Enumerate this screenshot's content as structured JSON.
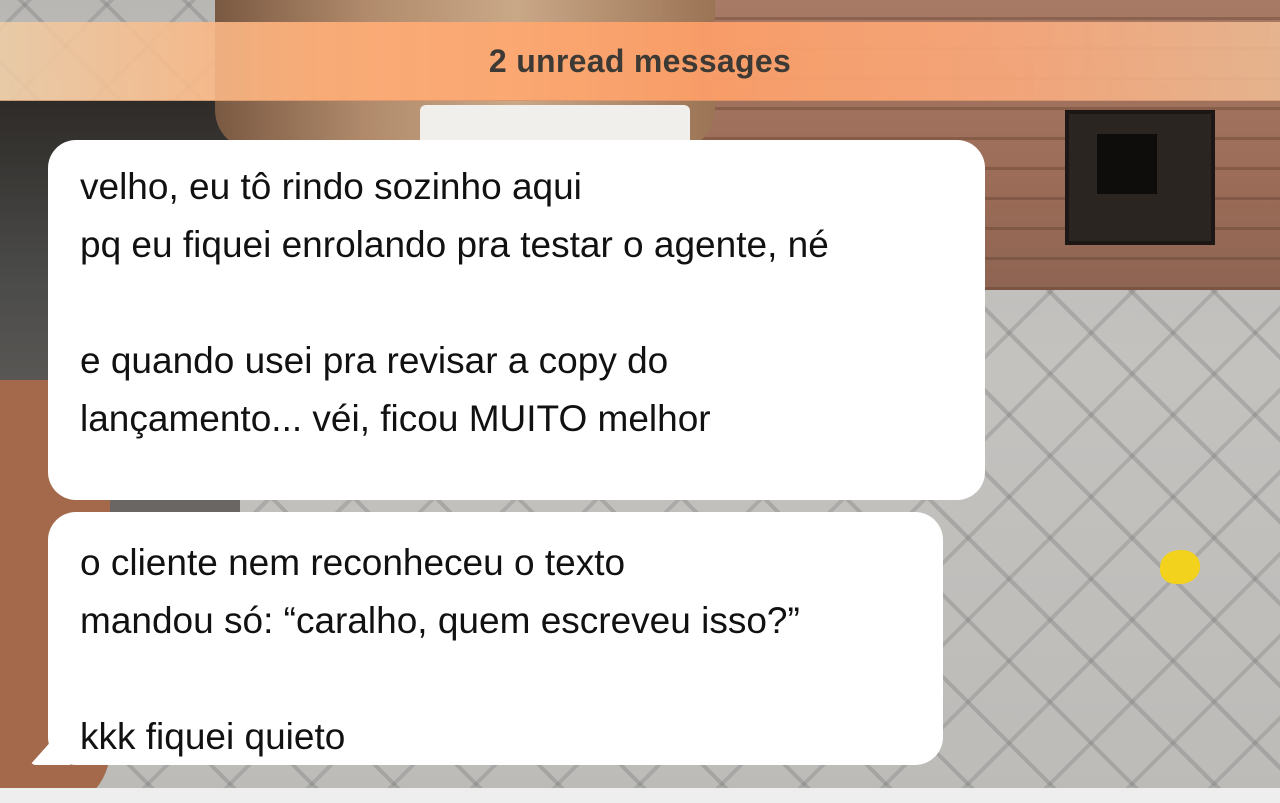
{
  "banner": {
    "unread_label": "2 unread messages"
  },
  "messages": [
    {
      "lines": [
        "velho, eu tô rindo sozinho aqui",
        "pq eu fiquei enrolando pra testar o agente, né",
        "",
        "e quando usei pra revisar a copy do",
        "lançamento... véi, ficou MUITO melhor"
      ]
    },
    {
      "lines": [
        "o cliente nem reconheceu o texto",
        "mandou só: “caralho, quem escreveu isso?”",
        "",
        "kkk fiquei quieto"
      ]
    }
  ],
  "colors": {
    "bubble": "#ffffff",
    "banner": "#ffa970",
    "text": "#111111"
  }
}
